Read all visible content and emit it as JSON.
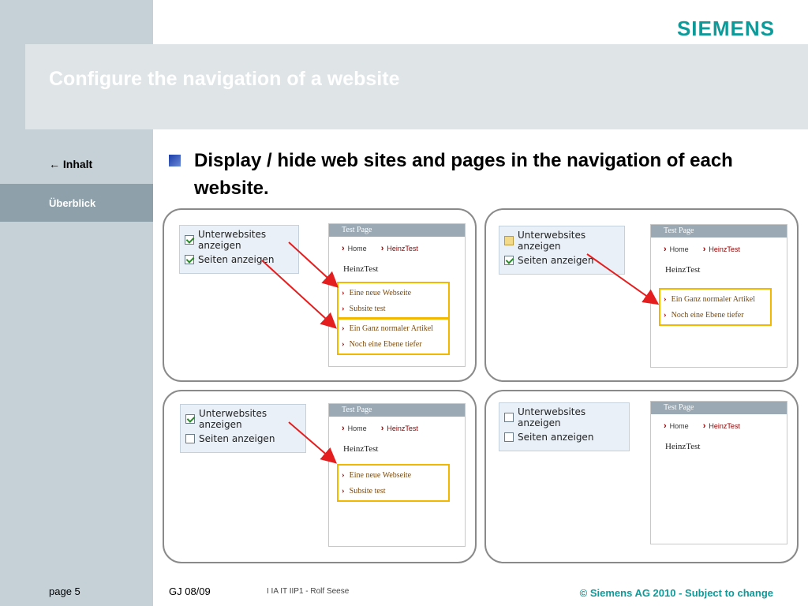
{
  "header": {
    "title": "Configure the navigation of a website",
    "logo": "SIEMENS"
  },
  "nav": {
    "inhalt": "Inhalt",
    "inhalt_arrow": "←",
    "ueberblick": "Überblick"
  },
  "heading": "Display / hide web sites and pages in the navigation of each website.",
  "labels": {
    "unterwebsites": "Unterwebsites anzeigen",
    "seiten": "Seiten anzeigen"
  },
  "site": {
    "header": "Test Page",
    "crumb_home": "Home",
    "crumb_current": "HeinzTest",
    "title": "HeinzTest",
    "subsite_items": [
      "Eine neue Webseite",
      "Subsite test"
    ],
    "page_items": [
      "Ein Ganz normaler Artikel",
      "Noch eine Ebene tiefer"
    ]
  },
  "panels": [
    {
      "name": "both-on",
      "unterwebsites": "checked",
      "seiten": "checked"
    },
    {
      "name": "pages-only",
      "unterwebsites": "partial",
      "seiten": "checked"
    },
    {
      "name": "subsites-only",
      "unterwebsites": "checked",
      "seiten": "unchecked"
    },
    {
      "name": "none",
      "unterwebsites": "unchecked",
      "seiten": "unchecked"
    }
  ],
  "colors": {
    "accent": "#0f9a9a",
    "highlight": "#f2b800",
    "arrow": "#e41e1e",
    "rail": "#c5d0d7"
  },
  "footer": {
    "page": "page 5",
    "gj": "GJ 08/09",
    "department": "I IA IT IIP1 - Rolf Seese",
    "copyright": "© Siemens AG 2010  -  Subject to change"
  }
}
